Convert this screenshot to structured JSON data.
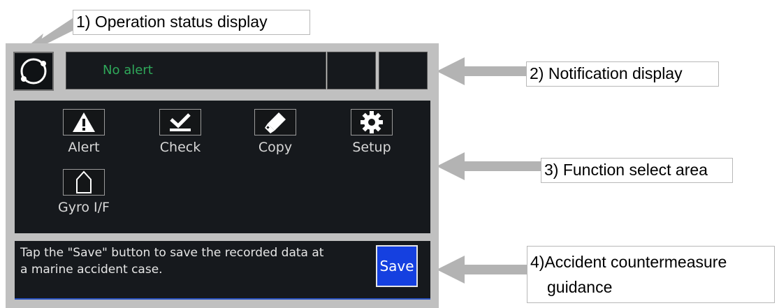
{
  "callouts": {
    "operation_status": "1) Operation status display",
    "notification": "2) Notification display",
    "function_select": "3) Function select area",
    "guidance_line1": "4)Accident countermeasure",
    "guidance_line2": "guidance"
  },
  "notification": {
    "text": "No alert"
  },
  "functions": [
    {
      "label": "Alert",
      "icon": "warning-triangle-icon"
    },
    {
      "label": "Check",
      "icon": "checkmark-icon"
    },
    {
      "label": "Copy",
      "icon": "usb-stick-icon"
    },
    {
      "label": "Setup",
      "icon": "gear-icon"
    },
    {
      "label": "Gyro I/F",
      "icon": "ship-bow-icon"
    }
  ],
  "guidance": {
    "text_line1": "Tap the \"Save\" button to save the recorded data at",
    "text_line2": "a marine accident case.",
    "save_label": "Save"
  },
  "colors": {
    "panel_bg": "#16191d",
    "frame": "#c0c0c0",
    "notification_text": "#2fa85a",
    "save_button": "#1540e0",
    "arrow": "#b3b3b3"
  }
}
